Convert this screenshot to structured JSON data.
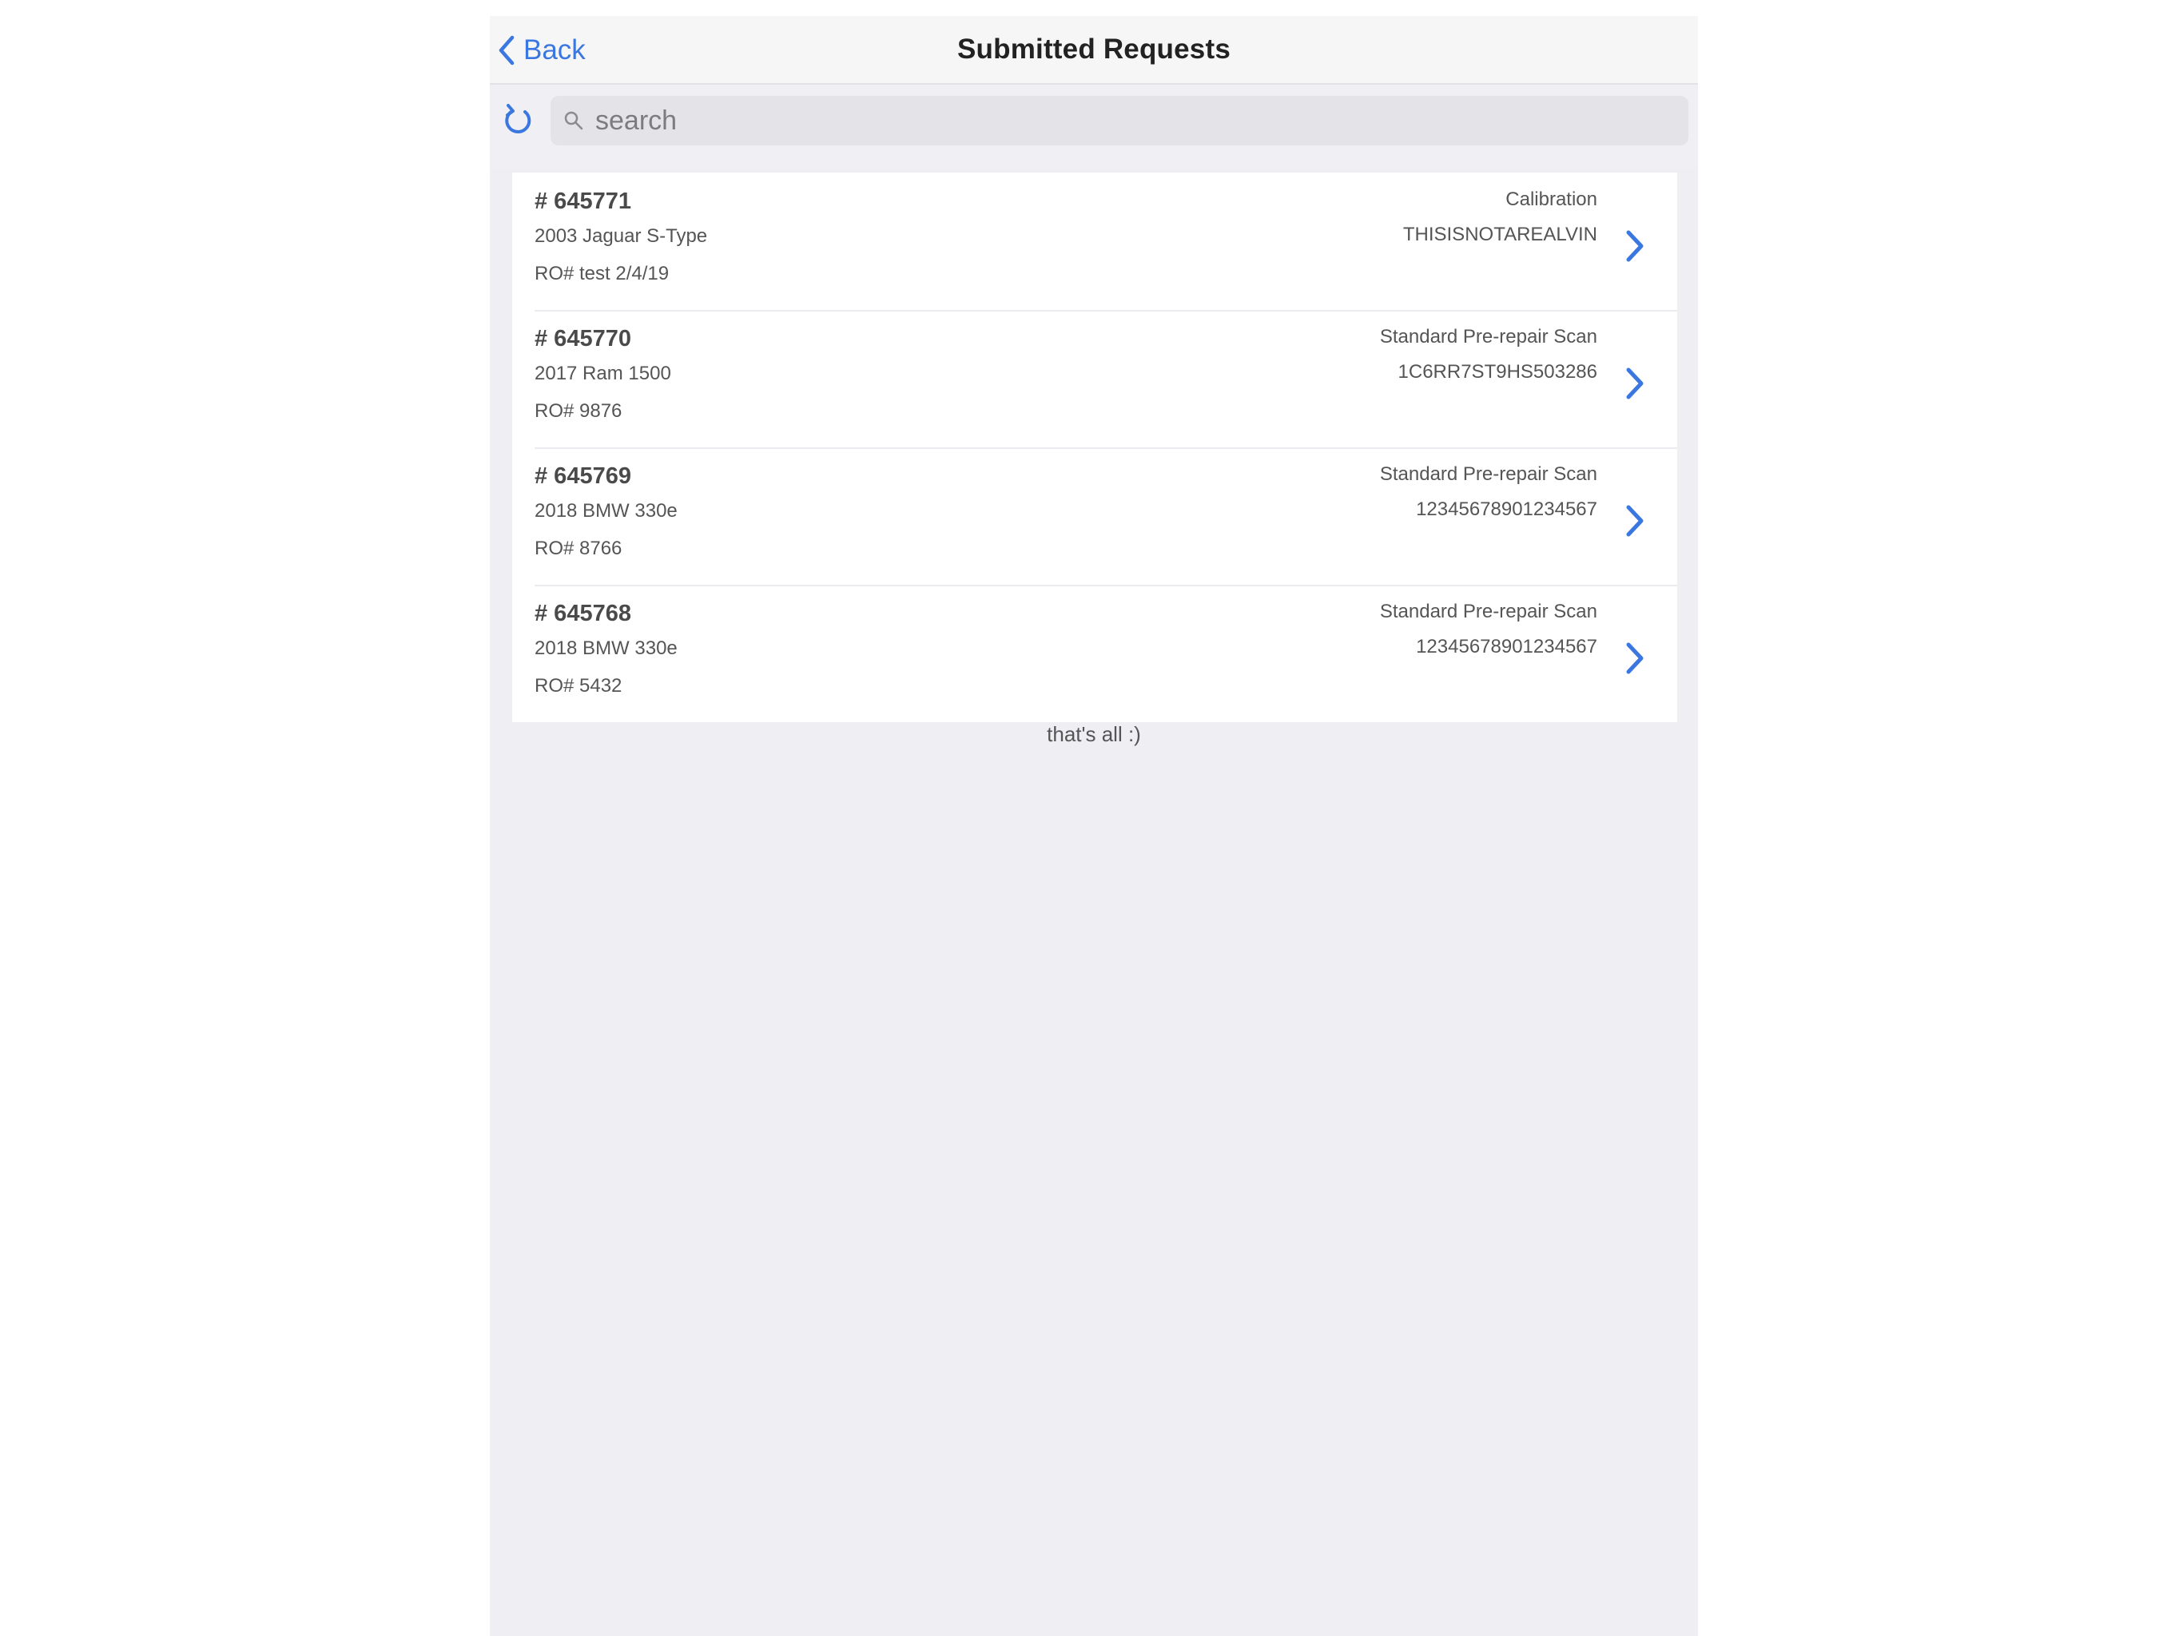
{
  "nav": {
    "back_label": "Back",
    "title": "Submitted Requests"
  },
  "search": {
    "placeholder": "search",
    "value": ""
  },
  "requests": [
    {
      "id": "# 645771",
      "vehicle": "2003 Jaguar S-Type",
      "ro": "RO# test 2/4/19",
      "type": "Calibration",
      "vin": "THISISNOTAREALVIN"
    },
    {
      "id": "# 645770",
      "vehicle": "2017 Ram 1500",
      "ro": "RO# 9876",
      "type": "Standard Pre-repair Scan",
      "vin": "1C6RR7ST9HS503286"
    },
    {
      "id": "# 645769",
      "vehicle": "2018 BMW 330e",
      "ro": "RO# 8766",
      "type": "Standard Pre-repair Scan",
      "vin": "12345678901234567"
    },
    {
      "id": "# 645768",
      "vehicle": "2018 BMW 330e",
      "ro": "RO# 5432",
      "type": "Standard Pre-repair Scan",
      "vin": "12345678901234567"
    }
  ],
  "footer": {
    "text": "that's all :)"
  },
  "colors": {
    "accent": "#3b77e0",
    "background": "#eeeef3",
    "navbar": "#f6f6f6"
  },
  "icons": [
    "chevron-left-icon",
    "refresh-icon",
    "search-icon",
    "chevron-right-icon"
  ]
}
